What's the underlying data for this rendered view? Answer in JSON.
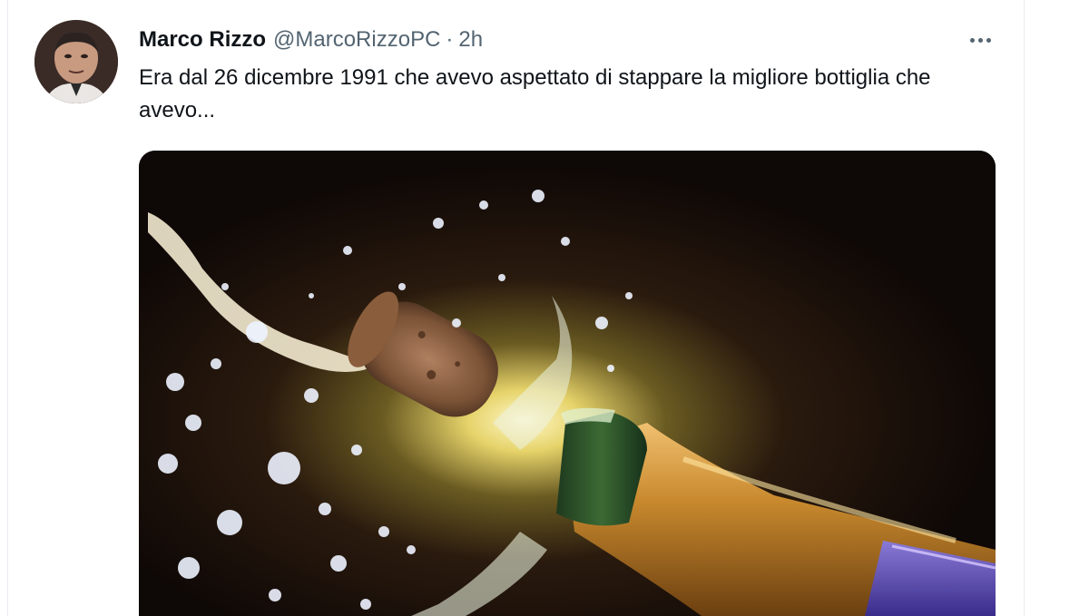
{
  "tweet": {
    "author_name": "Marco Rizzo",
    "author_handle": "@MarcoRizzoPC",
    "separator": "·",
    "timestamp": "2h",
    "text": "Era dal 26 dicembre 1991 che avevo aspettato di stappare la migliore bottiglia che avevo...",
    "more_icon": "more-horizontal-icon",
    "media_subject": "champagne bottle popping cork"
  },
  "colors": {
    "text_primary": "#0f1419",
    "text_secondary": "#536471",
    "border": "#e6ecf0"
  }
}
